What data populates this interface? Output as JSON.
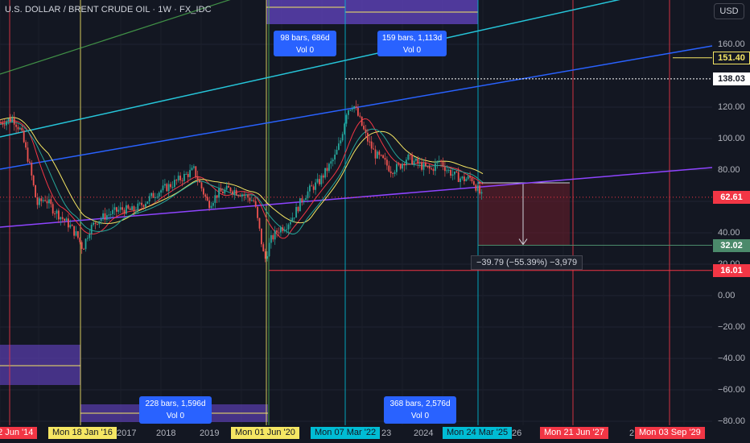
{
  "header": {
    "title": "U.S. DOLLAR / BRENT CRUDE OIL · 1W · FX_IDC",
    "currency_button": "USD"
  },
  "y_axis": {
    "ticks": [
      {
        "v": 160,
        "label": "160.00"
      },
      {
        "v": 120,
        "label": "120.00"
      },
      {
        "v": 100,
        "label": "100.00"
      },
      {
        "v": 80,
        "label": "80.00"
      },
      {
        "v": 60,
        "label": "60.00"
      },
      {
        "v": 40,
        "label": "40.00"
      },
      {
        "v": 20,
        "label": "20.00"
      },
      {
        "v": 0,
        "label": "0.00"
      },
      {
        "v": -20,
        "label": "−20.00"
      },
      {
        "v": -40,
        "label": "−40.00"
      },
      {
        "v": -60,
        "label": "−60.00"
      },
      {
        "v": -80,
        "label": "−80.00"
      }
    ],
    "price_tags": [
      {
        "v": 151.4,
        "label": "151.40",
        "bg": "#131722",
        "fg": "#f5e663",
        "border": "#f5e663"
      },
      {
        "v": 138.03,
        "label": "138.03",
        "bg": "#ffffff",
        "fg": "#131722",
        "border": "#ffffff"
      },
      {
        "v": 62.61,
        "label": "62.61",
        "bg": "#f23645",
        "fg": "#ffffff",
        "border": "#f23645"
      },
      {
        "v": 32.02,
        "label": "32.02",
        "bg": "#4b8a6b",
        "fg": "#ffffff",
        "border": "#4b8a6b"
      },
      {
        "v": 16.01,
        "label": "16.01",
        "bg": "#f23645",
        "fg": "#ffffff",
        "border": "#f23645"
      }
    ]
  },
  "x_axis": {
    "years": [
      {
        "label": "2017",
        "x": 145
      },
      {
        "label": "2018",
        "x": 194
      },
      {
        "label": "2019",
        "x": 248
      },
      {
        "label": "23",
        "x": 474
      },
      {
        "label": "2024",
        "x": 514
      },
      {
        "label": "26",
        "x": 636
      },
      {
        "label": "2",
        "x": 782
      }
    ],
    "tags": [
      {
        "label": "02 Jun '14",
        "x": -14,
        "bg": "#f23645",
        "fg": "#ffffff"
      },
      {
        "label": "Mon 18 Jan '16",
        "x": 60,
        "bg": "#f5e663",
        "fg": "#131722"
      },
      {
        "label": "Mon 01 Jun '20",
        "x": 287,
        "bg": "#f5e663",
        "fg": "#131722"
      },
      {
        "label": "Mon 07 Mar '22",
        "x": 386,
        "bg": "#00bcd4",
        "fg": "#131722"
      },
      {
        "label": "Mon 24 Mar '25",
        "x": 550,
        "bg": "#00bcd4",
        "fg": "#131722"
      },
      {
        "label": "Mon 21 Jun '27",
        "x": 671,
        "bg": "#f23645",
        "fg": "#ffffff"
      },
      {
        "label": "Mon 03 Sep '29",
        "x": 789,
        "bg": "#f23645",
        "fg": "#ffffff"
      }
    ]
  },
  "annotations": {
    "range_boxes": [
      {
        "bars": "98 bars, 686d",
        "vol": "Vol 0",
        "x": 340,
        "y": 38,
        "w": 78,
        "h": 32
      },
      {
        "bars": "159 bars, 1,113d",
        "vol": "Vol 0",
        "x": 469,
        "y": 38,
        "w": 86,
        "h": 32
      },
      {
        "bars": "228 bars, 1,596d",
        "vol": "Vol 0",
        "x": 173,
        "y": 492,
        "w": 90,
        "h": 34
      },
      {
        "bars": "368 bars, 2,576d",
        "vol": "Vol 0",
        "x": 477,
        "y": 492,
        "w": 90,
        "h": 34
      }
    ],
    "measure_label": "−39.79 (−55.39%) −3,979"
  },
  "chart_data": {
    "type": "candlestick",
    "title": "U.S. DOLLAR / BRENT CRUDE OIL · 1W · FX_IDC",
    "ylim": [
      -85,
      180
    ],
    "last_price": 62.61,
    "horizontal_levels": [
      151.4,
      138.03,
      32.02,
      16.01
    ],
    "measurement": {
      "from": 71.81,
      "to": 32.02,
      "change": -39.79,
      "change_pct": -55.39,
      "ticks": -3979
    },
    "vertical_markers": [
      "02 Jun '14",
      "Mon 18 Jan '16",
      "Mon 01 Jun '20",
      "Mon 07 Mar '22",
      "Mon 24 Mar '25",
      "Mon 21 Jun '27",
      "Mon 03 Sep '29"
    ],
    "price_path": [
      {
        "x": 0,
        "p": 110
      },
      {
        "x": 15,
        "p": 113
      },
      {
        "x": 25,
        "p": 105
      },
      {
        "x": 35,
        "p": 85
      },
      {
        "x": 45,
        "p": 58
      },
      {
        "x": 55,
        "p": 62
      },
      {
        "x": 65,
        "p": 55
      },
      {
        "x": 75,
        "p": 50
      },
      {
        "x": 85,
        "p": 45
      },
      {
        "x": 95,
        "p": 38
      },
      {
        "x": 102,
        "p": 30
      },
      {
        "x": 110,
        "p": 42
      },
      {
        "x": 120,
        "p": 48
      },
      {
        "x": 135,
        "p": 52
      },
      {
        "x": 150,
        "p": 55
      },
      {
        "x": 165,
        "p": 54
      },
      {
        "x": 180,
        "p": 60
      },
      {
        "x": 195,
        "p": 66
      },
      {
        "x": 210,
        "p": 70
      },
      {
        "x": 225,
        "p": 75
      },
      {
        "x": 240,
        "p": 80
      },
      {
        "x": 250,
        "p": 68
      },
      {
        "x": 258,
        "p": 58
      },
      {
        "x": 270,
        "p": 65
      },
      {
        "x": 285,
        "p": 68
      },
      {
        "x": 300,
        "p": 65
      },
      {
        "x": 315,
        "p": 60
      },
      {
        "x": 322,
        "p": 40
      },
      {
        "x": 328,
        "p": 22
      },
      {
        "x": 335,
        "p": 35
      },
      {
        "x": 345,
        "p": 42
      },
      {
        "x": 355,
        "p": 45
      },
      {
        "x": 365,
        "p": 52
      },
      {
        "x": 375,
        "p": 62
      },
      {
        "x": 385,
        "p": 68
      },
      {
        "x": 395,
        "p": 72
      },
      {
        "x": 405,
        "p": 80
      },
      {
        "x": 415,
        "p": 88
      },
      {
        "x": 422,
        "p": 98
      },
      {
        "x": 430,
        "p": 118
      },
      {
        "x": 438,
        "p": 122
      },
      {
        "x": 446,
        "p": 112
      },
      {
        "x": 455,
        "p": 100
      },
      {
        "x": 465,
        "p": 90
      },
      {
        "x": 475,
        "p": 86
      },
      {
        "x": 485,
        "p": 80
      },
      {
        "x": 495,
        "p": 82
      },
      {
        "x": 505,
        "p": 88
      },
      {
        "x": 515,
        "p": 85
      },
      {
        "x": 525,
        "p": 82
      },
      {
        "x": 535,
        "p": 80
      },
      {
        "x": 545,
        "p": 86
      },
      {
        "x": 555,
        "p": 80
      },
      {
        "x": 565,
        "p": 76
      },
      {
        "x": 575,
        "p": 74
      },
      {
        "x": 585,
        "p": 75
      },
      {
        "x": 592,
        "p": 68
      },
      {
        "x": 598,
        "p": 62.61
      }
    ]
  }
}
